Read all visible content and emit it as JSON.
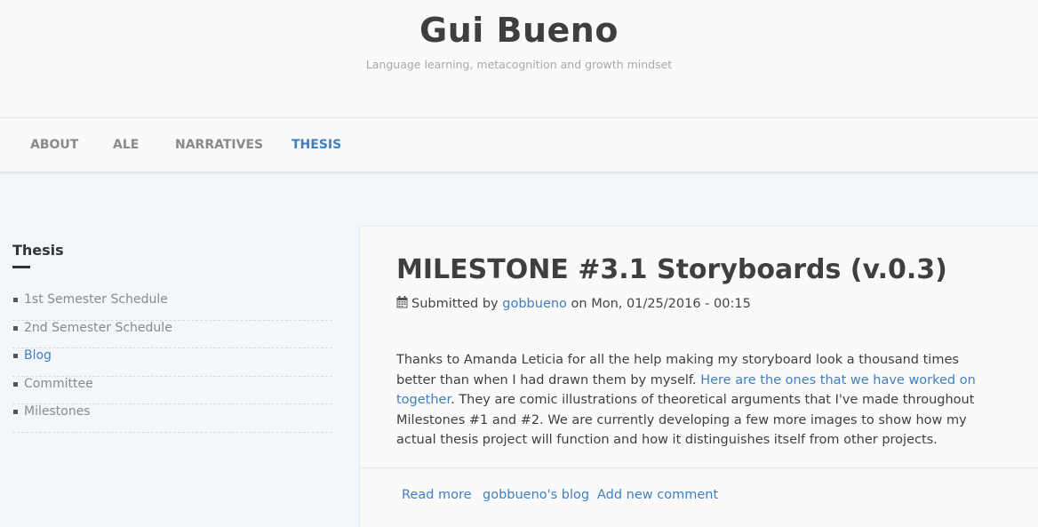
{
  "header": {
    "site_name": "Gui Bueno",
    "slogan": "Language learning, metacognition and growth mindset"
  },
  "nav": {
    "items": [
      {
        "label": "ABOUT",
        "active": false
      },
      {
        "label": "ALE",
        "active": false
      },
      {
        "label": "NARRATIVES",
        "active": false
      },
      {
        "label": "THESIS",
        "active": true
      }
    ]
  },
  "sidebar": {
    "title": "Thesis",
    "items": [
      {
        "label": "1st Semester Schedule",
        "active": false
      },
      {
        "label": "2nd Semester Schedule",
        "active": false
      },
      {
        "label": "Blog",
        "active": true
      },
      {
        "label": "Committee",
        "active": false
      },
      {
        "label": "Milestones",
        "active": false
      }
    ]
  },
  "article": {
    "title": "MILESTONE #3.1 Storyboards (v.0.3)",
    "submitted_prefix": "Submitted by",
    "author": "gobbueno",
    "submitted_on": "on Mon, 01/25/2016 - 00:15",
    "body_part1": "Thanks to Amanda Leticia for all the help making my storyboard look a thousand times better than when I had drawn them by myself. ",
    "body_link": "Here are the ones that we have worked on together",
    "body_part2": ". They are comic illustrations of theoretical arguments that I've made throughout Milestones #1 and #2. We are currently developing a few more images to show how my actual thesis project will function and how it distinguishes itself from other projects.",
    "links": {
      "read_more": "Read more",
      "blog": "gobbueno's blog",
      "add_comment": "Add new comment"
    }
  },
  "colors": {
    "accent": "#3f7fbf",
    "page_bg": "#f3f6fa",
    "card_bg": "#fafafa"
  },
  "icons": {
    "submitted": "calendar-icon",
    "sidebar_bullet": "square-bullet-icon"
  }
}
